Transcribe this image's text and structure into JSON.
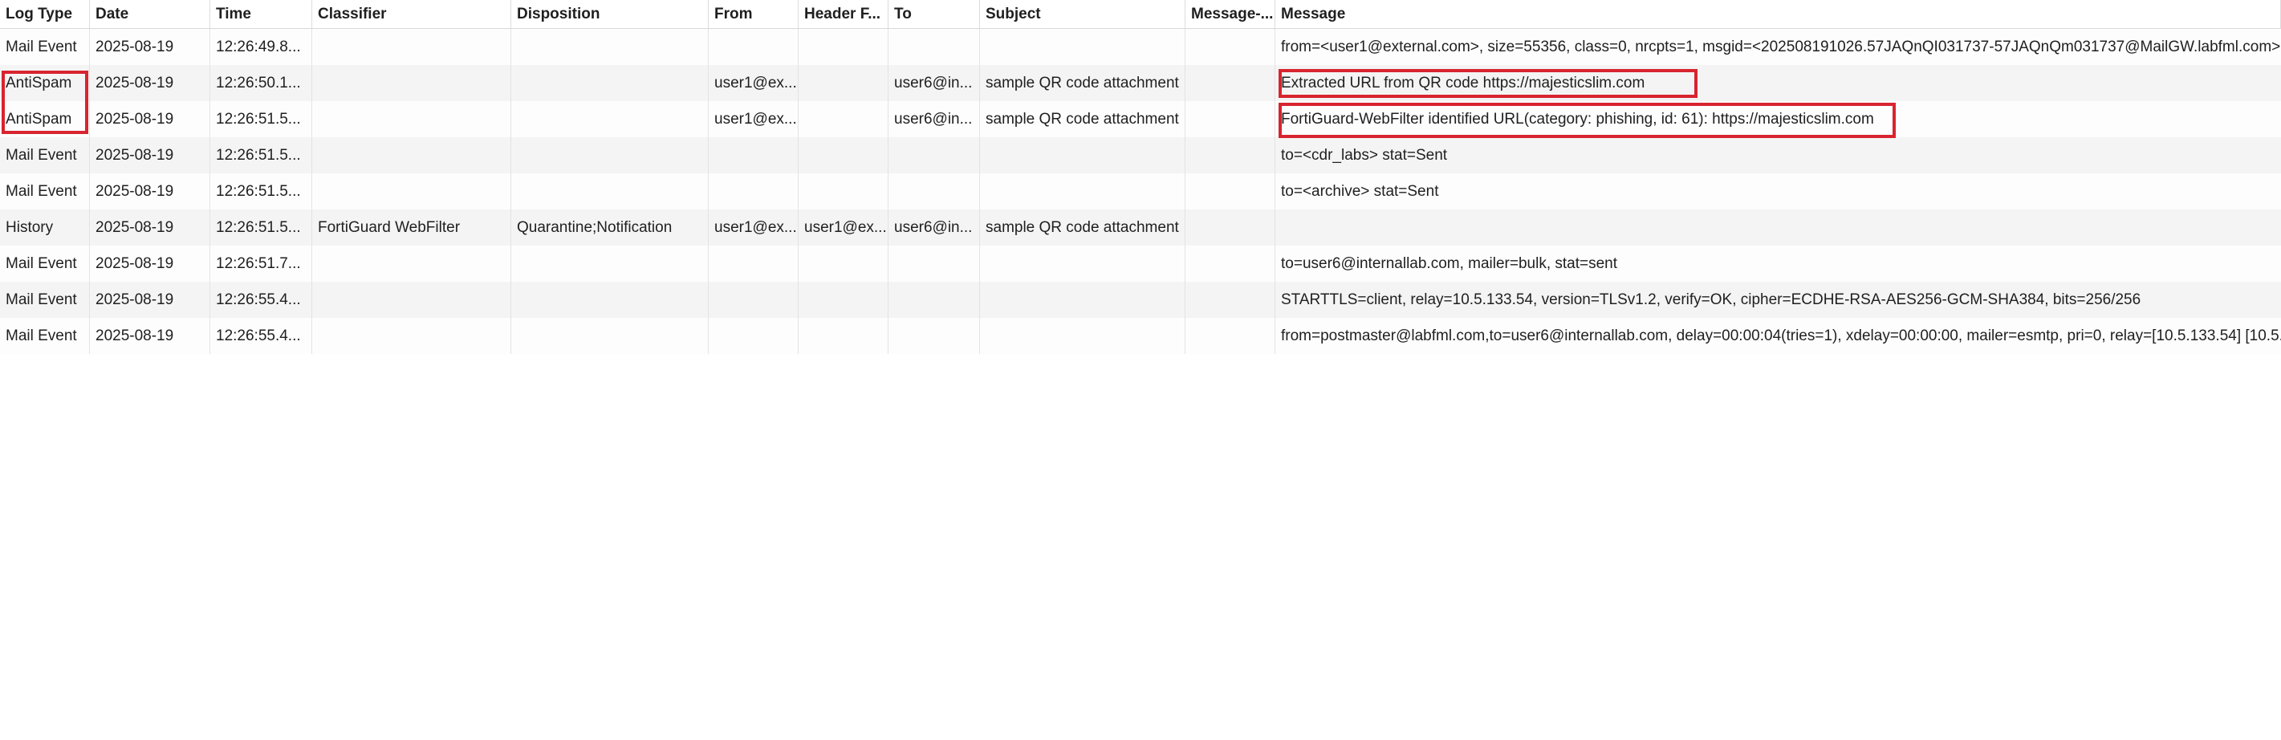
{
  "columns": [
    "Log Type",
    "Date",
    "Time",
    "Classifier",
    "Disposition",
    "From",
    "Header F...",
    "To",
    "Subject",
    "Message-...",
    "Message"
  ],
  "rows": [
    [
      "Mail Event",
      "2025-08-19",
      "12:26:49.8...",
      "",
      "",
      "",
      "",
      "",
      "",
      "",
      "from=<user1@external.com>, size=55356, class=0, nrcpts=1, msgid=<202508191026.57JAQnQI031737-57JAQnQm031737@MailGW.labfml.com>"
    ],
    [
      "AntiSpam",
      "2025-08-19",
      "12:26:50.1...",
      "",
      "",
      "user1@ex...",
      "",
      "user6@in...",
      "sample QR code attachment",
      "",
      "Extracted URL from QR code https://majesticslim.com"
    ],
    [
      "AntiSpam",
      "2025-08-19",
      "12:26:51.5...",
      "",
      "",
      "user1@ex...",
      "",
      "user6@in...",
      "sample QR code attachment",
      "",
      "FortiGuard-WebFilter identified URL(category: phishing, id: 61): https://majesticslim.com"
    ],
    [
      "Mail Event",
      "2025-08-19",
      "12:26:51.5...",
      "",
      "",
      "",
      "",
      "",
      "",
      "",
      "to=<cdr_labs> stat=Sent"
    ],
    [
      "Mail Event",
      "2025-08-19",
      "12:26:51.5...",
      "",
      "",
      "",
      "",
      "",
      "",
      "",
      "to=<archive> stat=Sent"
    ],
    [
      "History",
      "2025-08-19",
      "12:26:51.5...",
      "FortiGuard WebFilter",
      "Quarantine;Notification",
      "user1@ex...",
      "user1@ex...",
      "user6@in...",
      "sample QR code attachment",
      "",
      ""
    ],
    [
      "Mail Event",
      "2025-08-19",
      "12:26:51.7...",
      "",
      "",
      "",
      "",
      "",
      "",
      "",
      "to=user6@internallab.com, mailer=bulk, stat=sent"
    ],
    [
      "Mail Event",
      "2025-08-19",
      "12:26:55.4...",
      "",
      "",
      "",
      "",
      "",
      "",
      "",
      "STARTTLS=client, relay=10.5.133.54, version=TLSv1.2, verify=OK, cipher=ECDHE-RSA-AES256-GCM-SHA384, bits=256/256"
    ],
    [
      "Mail Event",
      "2025-08-19",
      "12:26:55.4...",
      "",
      "",
      "",
      "",
      "",
      "",
      "",
      "from=postmaster@labfml.com,to=user6@internallab.com, delay=00:00:04(tries=1), xdelay=00:00:00, mailer=esmtp, pri=0, relay=[10.5.133.54] [10.5."
    ]
  ],
  "highlight_color": "#d8242f"
}
